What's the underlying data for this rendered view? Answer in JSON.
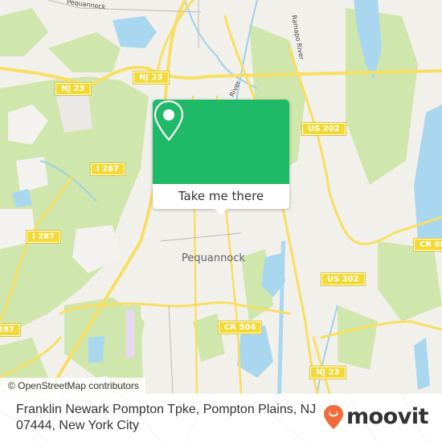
{
  "map": {
    "place_labels": {
      "pequannock": "Pequannock",
      "pequannock_top": "Pequannock",
      "ramapo_river": "Ramapo River",
      "river_small": "River"
    },
    "road_shields": {
      "nj23_a": "NJ 23",
      "nj23_b": "NJ 23",
      "nj23_c": "NJ 23",
      "i287_a": "I 287",
      "i287_b": "I 287",
      "i287_c": "287",
      "us202_a": "US 202",
      "us202_b": "US 202",
      "cr504": "CR 504",
      "cr68": "CR 68"
    },
    "attribution": "© OpenStreetMap contributors",
    "colors": {
      "land": "#f2f0ea",
      "park": "#cde6a8",
      "water": "#a9d7f0",
      "road": "#f7df63",
      "shield": "#f2d933"
    }
  },
  "popup": {
    "icon": "map-pin-icon",
    "button_label": "Take me there",
    "color": "#1fba67"
  },
  "footer": {
    "address": "Franklin Newark Pompton Tpke, Pompton Plains, NJ 07444, New York City",
    "brand": "moovit",
    "brand_icon": "moovit-logo-pin-icon",
    "brand_color": "#f26b3a"
  }
}
